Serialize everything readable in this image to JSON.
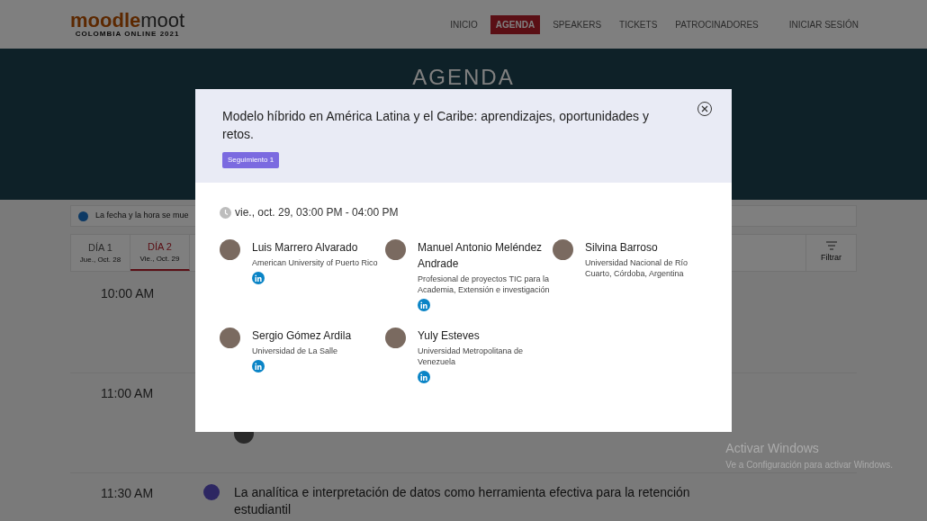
{
  "header": {
    "logo": {
      "main": "moodle",
      "accent": "moot",
      "subtitle": "COLOMBIA ONLINE 2021"
    },
    "nav": [
      {
        "label": "INICIO",
        "selected": false
      },
      {
        "label": "AGENDA",
        "selected": true
      },
      {
        "label": "SPEAKERS",
        "selected": false
      },
      {
        "label": "TICKETS",
        "selected": false
      },
      {
        "label": "PATROCINADORES",
        "selected": false
      }
    ],
    "login": "INICIAR SESIÓN"
  },
  "hero": {
    "title": "AGENDA"
  },
  "info_bar": {
    "text": "La fecha y la hora se mue"
  },
  "day_tabs": [
    {
      "label": "DÍA 1",
      "date": "Jue., Oct. 28",
      "selected": false
    },
    {
      "label": "DÍA 2",
      "date": "Vie., Oct. 29",
      "selected": true
    }
  ],
  "filter": {
    "label": "Filtrar"
  },
  "schedule": [
    {
      "time": "10:00 AM"
    },
    {
      "time": "11:00 AM",
      "speaker_avatar": true
    },
    {
      "time": "11:30 AM",
      "title": "La analítica e interpretación de datos como herramienta efectiva para la retención estudiantil"
    }
  ],
  "modal": {
    "title": "Modelo híbrido en América Latina y el Caribe: aprendizajes, oportunidades y retos.",
    "badge": "Seguimiento 1",
    "datetime": "vie., oct. 29, 03:00 PM - 04:00 PM",
    "speakers": [
      {
        "name": "Luis Marrero Alvarado",
        "affiliation": "American University of Puerto Rico",
        "linkedin": true
      },
      {
        "name": "Manuel Antonio Meléndez Andrade",
        "affiliation": "Profesional de proyectos TIC para la Academia, Extensión e investigación",
        "linkedin": true
      },
      {
        "name": "Silvina Barroso",
        "affiliation": "Universidad Nacional de Río Cuarto, Córdoba, Argentina",
        "linkedin": false
      },
      {
        "name": "Sergio Gómez Ardila",
        "affiliation": "Universidad de La Salle",
        "linkedin": true
      },
      {
        "name": "Yuly Esteves",
        "affiliation": "Universidad Metropolitana de Venezuela",
        "linkedin": true
      }
    ]
  },
  "os_notice": {
    "title": "Activar Windows",
    "text": "Ve a Configuración para activar Windows."
  }
}
